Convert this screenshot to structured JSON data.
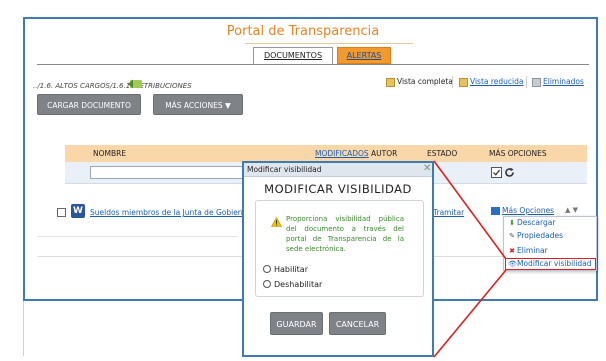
{
  "portal": {
    "title": "Portal de Transparencia"
  },
  "tabs": [
    {
      "label": "DOCUMENTOS"
    },
    {
      "label": "ALERTAS"
    }
  ],
  "breadcrumb": "../1.6. ALTOS CARGOS/1.6.1. RETRIBUCIONES",
  "views": {
    "completa": "Vista completa",
    "reducida": "Vista reducida",
    "eliminados": "Eliminados"
  },
  "actions": {
    "cargar": "CARGAR DOCUMENTO",
    "mas": "MÁS ACCIONES ▼"
  },
  "table": {
    "columns": {
      "nombre": "NOMBRE",
      "modificados": "MODIFICADOS",
      "autor": "AUTOR",
      "estado": "ESTADO",
      "mas_opciones": "MÁS OPCIONES"
    },
    "rows": [
      {
        "nombre": "Sueldos miembros de la Junta de Gobierno",
        "estado": "Tramitar",
        "mas_opciones": "Más Opciones"
      }
    ]
  },
  "context_menu": {
    "items": [
      {
        "label": "Descargar",
        "icon": "download-icon"
      },
      {
        "label": "Propiedades",
        "icon": "pencil-icon"
      },
      {
        "label": "Eliminar",
        "icon": "delete-icon"
      },
      {
        "label": "Modificar visibilidad",
        "icon": "eye-icon"
      }
    ]
  },
  "dialog": {
    "window_title": "Modificar visibilidad",
    "heading": "MODIFICAR VISIBILIDAD",
    "message": "Proporciona visibilidad pública del documento a través del portal de Transparencia de la sede electrónica.",
    "options": [
      "Habilitar",
      "Deshabilitar"
    ],
    "buttons": {
      "guardar": "GUARDAR",
      "cancelar": "CANCELAR"
    }
  },
  "colors": {
    "accent_orange": "#f29a2e",
    "title_orange": "#e88424",
    "frame_blue": "#3d7bb5",
    "highlight_red": "#e02020",
    "link_blue": "#1a5fb4"
  }
}
